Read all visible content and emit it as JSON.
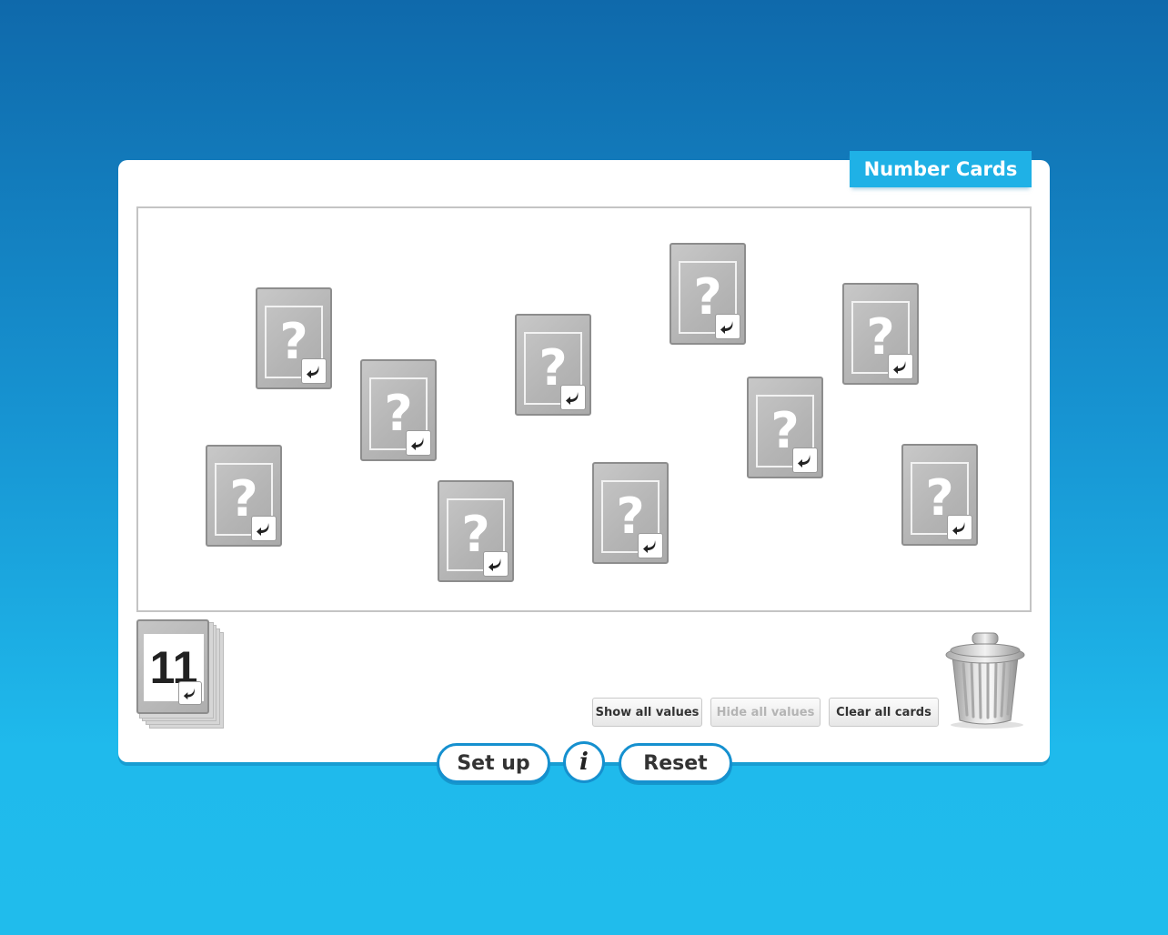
{
  "app": {
    "title": "Number Cards"
  },
  "cards": [
    {
      "symbol": "?"
    },
    {
      "symbol": "?"
    },
    {
      "symbol": "?"
    },
    {
      "symbol": "?"
    },
    {
      "symbol": "?"
    },
    {
      "symbol": "?"
    },
    {
      "symbol": "?"
    },
    {
      "symbol": "?"
    },
    {
      "symbol": "?"
    },
    {
      "symbol": "?"
    }
  ],
  "deck": {
    "value": "11"
  },
  "toolbar": {
    "show_all_label": "Show all values",
    "hide_all_label": "Hide all values",
    "clear_all_label": "Clear all cards"
  },
  "footer": {
    "setup_label": "Set up",
    "info_label": "i",
    "reset_label": "Reset"
  },
  "icons": {
    "flip": "flip-arrow-icon",
    "trash": "trash-can-icon"
  },
  "colors": {
    "title_tab": "#1fb1e6",
    "pill_border": "#1590cf",
    "card_gray": "#b4b4b4"
  }
}
